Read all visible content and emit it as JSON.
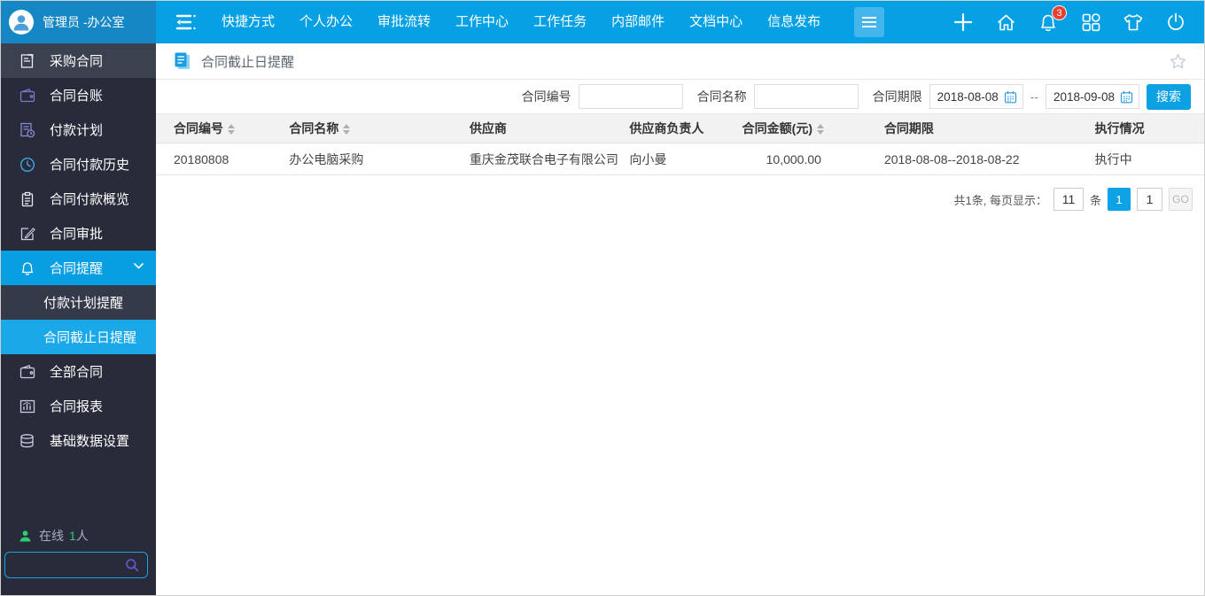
{
  "topbar": {
    "user_name": "管理员 -办公室",
    "nav_items": [
      "快捷方式",
      "个人办公",
      "审批流转",
      "工作中心",
      "工作任务",
      "内部邮件",
      "文档中心",
      "信息发布"
    ],
    "notification_count": "3"
  },
  "sidebar": {
    "items": [
      {
        "label": "采购合同"
      },
      {
        "label": "合同台账"
      },
      {
        "label": "付款计划"
      },
      {
        "label": "合同付款历史"
      },
      {
        "label": "合同付款概览"
      },
      {
        "label": "合同审批"
      },
      {
        "label": "合同提醒"
      },
      {
        "label": "付款计划提醒"
      },
      {
        "label": "合同截止日提醒"
      },
      {
        "label": "全部合同"
      },
      {
        "label": "合同报表"
      },
      {
        "label": "基础数据设置"
      }
    ],
    "online_prefix": "在线",
    "online_count": "1",
    "online_suffix": "人"
  },
  "page": {
    "title": "合同截止日提醒",
    "filters": {
      "contract_no_label": "合同编号",
      "contract_name_label": "合同名称",
      "period_label": "合同期限",
      "date_from": "2018-08-08",
      "date_to": "2018-09-08",
      "range_separator": "--",
      "search_button": "搜索"
    },
    "table": {
      "columns": [
        {
          "label": "合同编号"
        },
        {
          "label": "合同名称"
        },
        {
          "label": "供应商"
        },
        {
          "label": "供应商负责人"
        },
        {
          "label": "合同金额(元)"
        },
        {
          "label": "合同期限"
        },
        {
          "label": "执行情况"
        }
      ],
      "rows": [
        [
          "20180808",
          "办公电脑采购",
          "重庆金茂联合电子有限公司",
          "向小曼",
          "10,000.00",
          "2018-08-08--2018-08-22",
          "执行中"
        ]
      ]
    },
    "pagination": {
      "summary": "共1条, 每页显示：",
      "page_size": "11",
      "unit": "条",
      "current_page": "1",
      "goto_value": "1",
      "go_label": "GO"
    }
  },
  "colors": {
    "topbar_blue": "#05a1e4",
    "topbar_user_blue": "#1487c4",
    "sidebar_dark": "#282c3a",
    "active_blue": "#089fe2",
    "badge_red": "#e8402d",
    "online_green": "#2ecc71",
    "table_header_gray": "#f2f2f3"
  }
}
